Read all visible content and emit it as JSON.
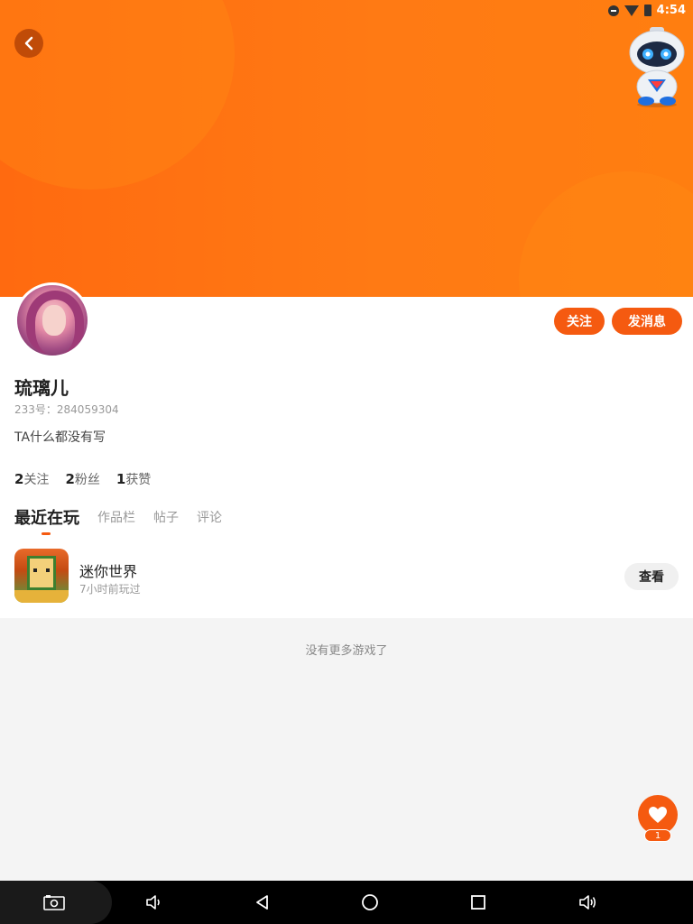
{
  "status_bar": {
    "time": "4:54"
  },
  "profile": {
    "name": "琉璃儿",
    "uid": "233号：284059304",
    "bio": "TA什么都没有写",
    "follow_label": "关注",
    "message_label": "发消息",
    "stats": [
      {
        "count": "2",
        "label": "关注"
      },
      {
        "count": "2",
        "label": "粉丝"
      },
      {
        "count": "1",
        "label": "获赞"
      }
    ]
  },
  "tabs": [
    {
      "label": "最近在玩",
      "active": true
    },
    {
      "label": "作品栏",
      "active": false
    },
    {
      "label": "帖子",
      "active": false
    },
    {
      "label": "评论",
      "active": false
    }
  ],
  "recent_game": {
    "name": "迷你世界",
    "last_played": "7小时前玩过",
    "view_label": "查看"
  },
  "empty_text": "没有更多游戏了",
  "like_fab": {
    "count": "1"
  },
  "colors": {
    "accent": "#f55a10",
    "hero": "#ff7510"
  },
  "icons": [
    "back-arrow-icon",
    "robot-mascot-icon",
    "heart-icon",
    "screenshot-icon",
    "volume-down-icon",
    "back-icon",
    "home-icon",
    "recents-icon",
    "volume-up-icon"
  ]
}
